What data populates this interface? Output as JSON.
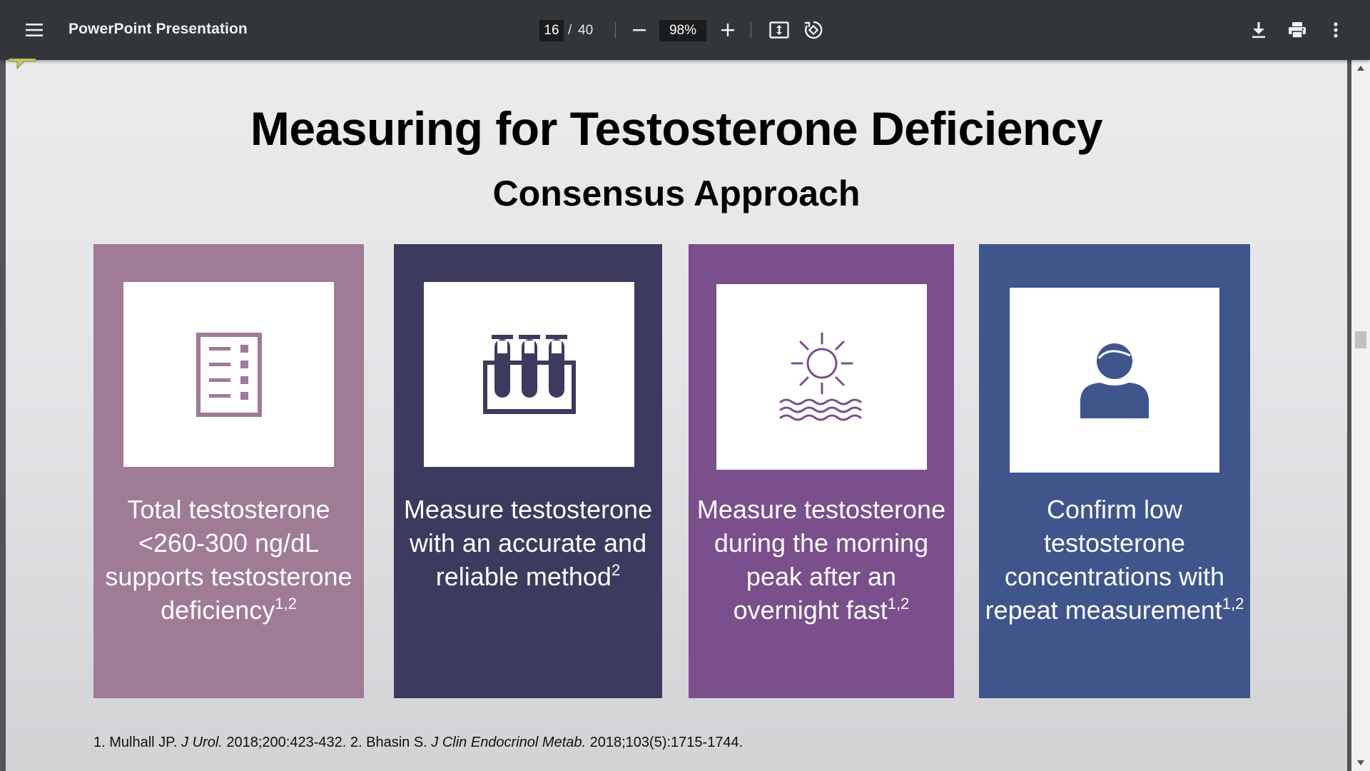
{
  "toolbar": {
    "title": "PowerPoint Presentation",
    "current_page": "16",
    "page_separator": "/",
    "total_pages": "40",
    "zoom": "98%",
    "icons": [
      "menu-icon",
      "minus-icon",
      "plus-icon",
      "fit-page-icon",
      "rotate-icon",
      "download-icon",
      "print-icon",
      "more-vert-icon"
    ]
  },
  "slide": {
    "title": "Measuring for Testosterone Deficiency",
    "subtitle": "Consensus Approach",
    "cards": [
      {
        "text": "Total testosterone <260-300 ng/dL supports testosterone deficiency",
        "sup": "1,2",
        "icon": "checklist-icon",
        "color": "#9f7b96"
      },
      {
        "text": "Measure testosterone with an accurate and reliable method",
        "sup": "2",
        "icon": "test-tubes-icon",
        "color": "#3d3a5f"
      },
      {
        "text": "Measure testosterone during the morning peak after an overnight fast",
        "sup": "1,2",
        "icon": "sunrise-icon",
        "color": "#7a4f8c"
      },
      {
        "text": "Confirm low testosterone concentrations with repeat measurement",
        "sup": "1,2",
        "icon": "person-icon",
        "color": "#3f558c"
      }
    ],
    "references": {
      "r1_prefix": "1. Mulhall JP. ",
      "r1_journal": "J Urol.",
      "r1_rest": " 2018;200:423-432.  2. Bhasin S. ",
      "r2_journal": "J Clin Endocrinol Metab.",
      "r2_rest": " 2018;103(5):1715-1744."
    }
  }
}
